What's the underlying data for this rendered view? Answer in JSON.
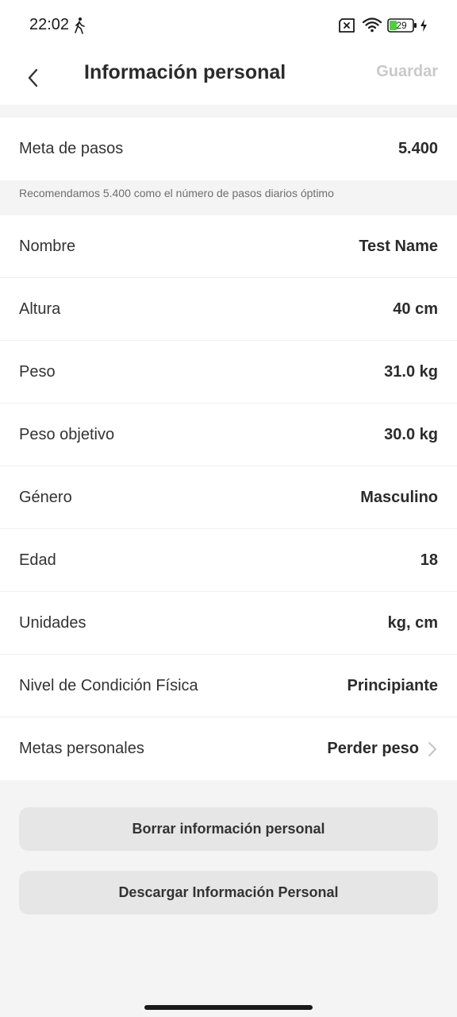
{
  "status_bar": {
    "time": "22:02",
    "battery": "29"
  },
  "header": {
    "title": "Información personal",
    "save_label": "Guardar"
  },
  "step_goal": {
    "label": "Meta de pasos",
    "value": "5.400",
    "hint": "Recomendamos 5.400 como el número de pasos diarios óptimo"
  },
  "profile": {
    "rows": [
      {
        "label": "Nombre",
        "value": "Test Name"
      },
      {
        "label": "Altura",
        "value": "40 cm"
      },
      {
        "label": "Peso",
        "value": "31.0 kg"
      },
      {
        "label": "Peso objetivo",
        "value": "30.0 kg"
      },
      {
        "label": "Género",
        "value": "Masculino"
      },
      {
        "label": "Edad",
        "value": "18"
      },
      {
        "label": "Unidades",
        "value": "kg, cm"
      },
      {
        "label": "Nivel de Condición Física",
        "value": "Principiante"
      },
      {
        "label": "Metas personales",
        "value": "Perder peso"
      }
    ]
  },
  "actions": {
    "delete_label": "Borrar información personal",
    "download_label": "Descargar Información Personal"
  },
  "icons": {
    "status": [
      "walk-icon",
      "sim-icon",
      "wifi-icon",
      "battery-icon",
      "bolt-icon"
    ],
    "nav": [
      "back-arrow-icon",
      "chevron-right-icon"
    ]
  },
  "colors": {
    "accent_disabled": "#c9c9c9",
    "battery_fill": "#4cd137",
    "button_bg": "#e6e6e6"
  }
}
